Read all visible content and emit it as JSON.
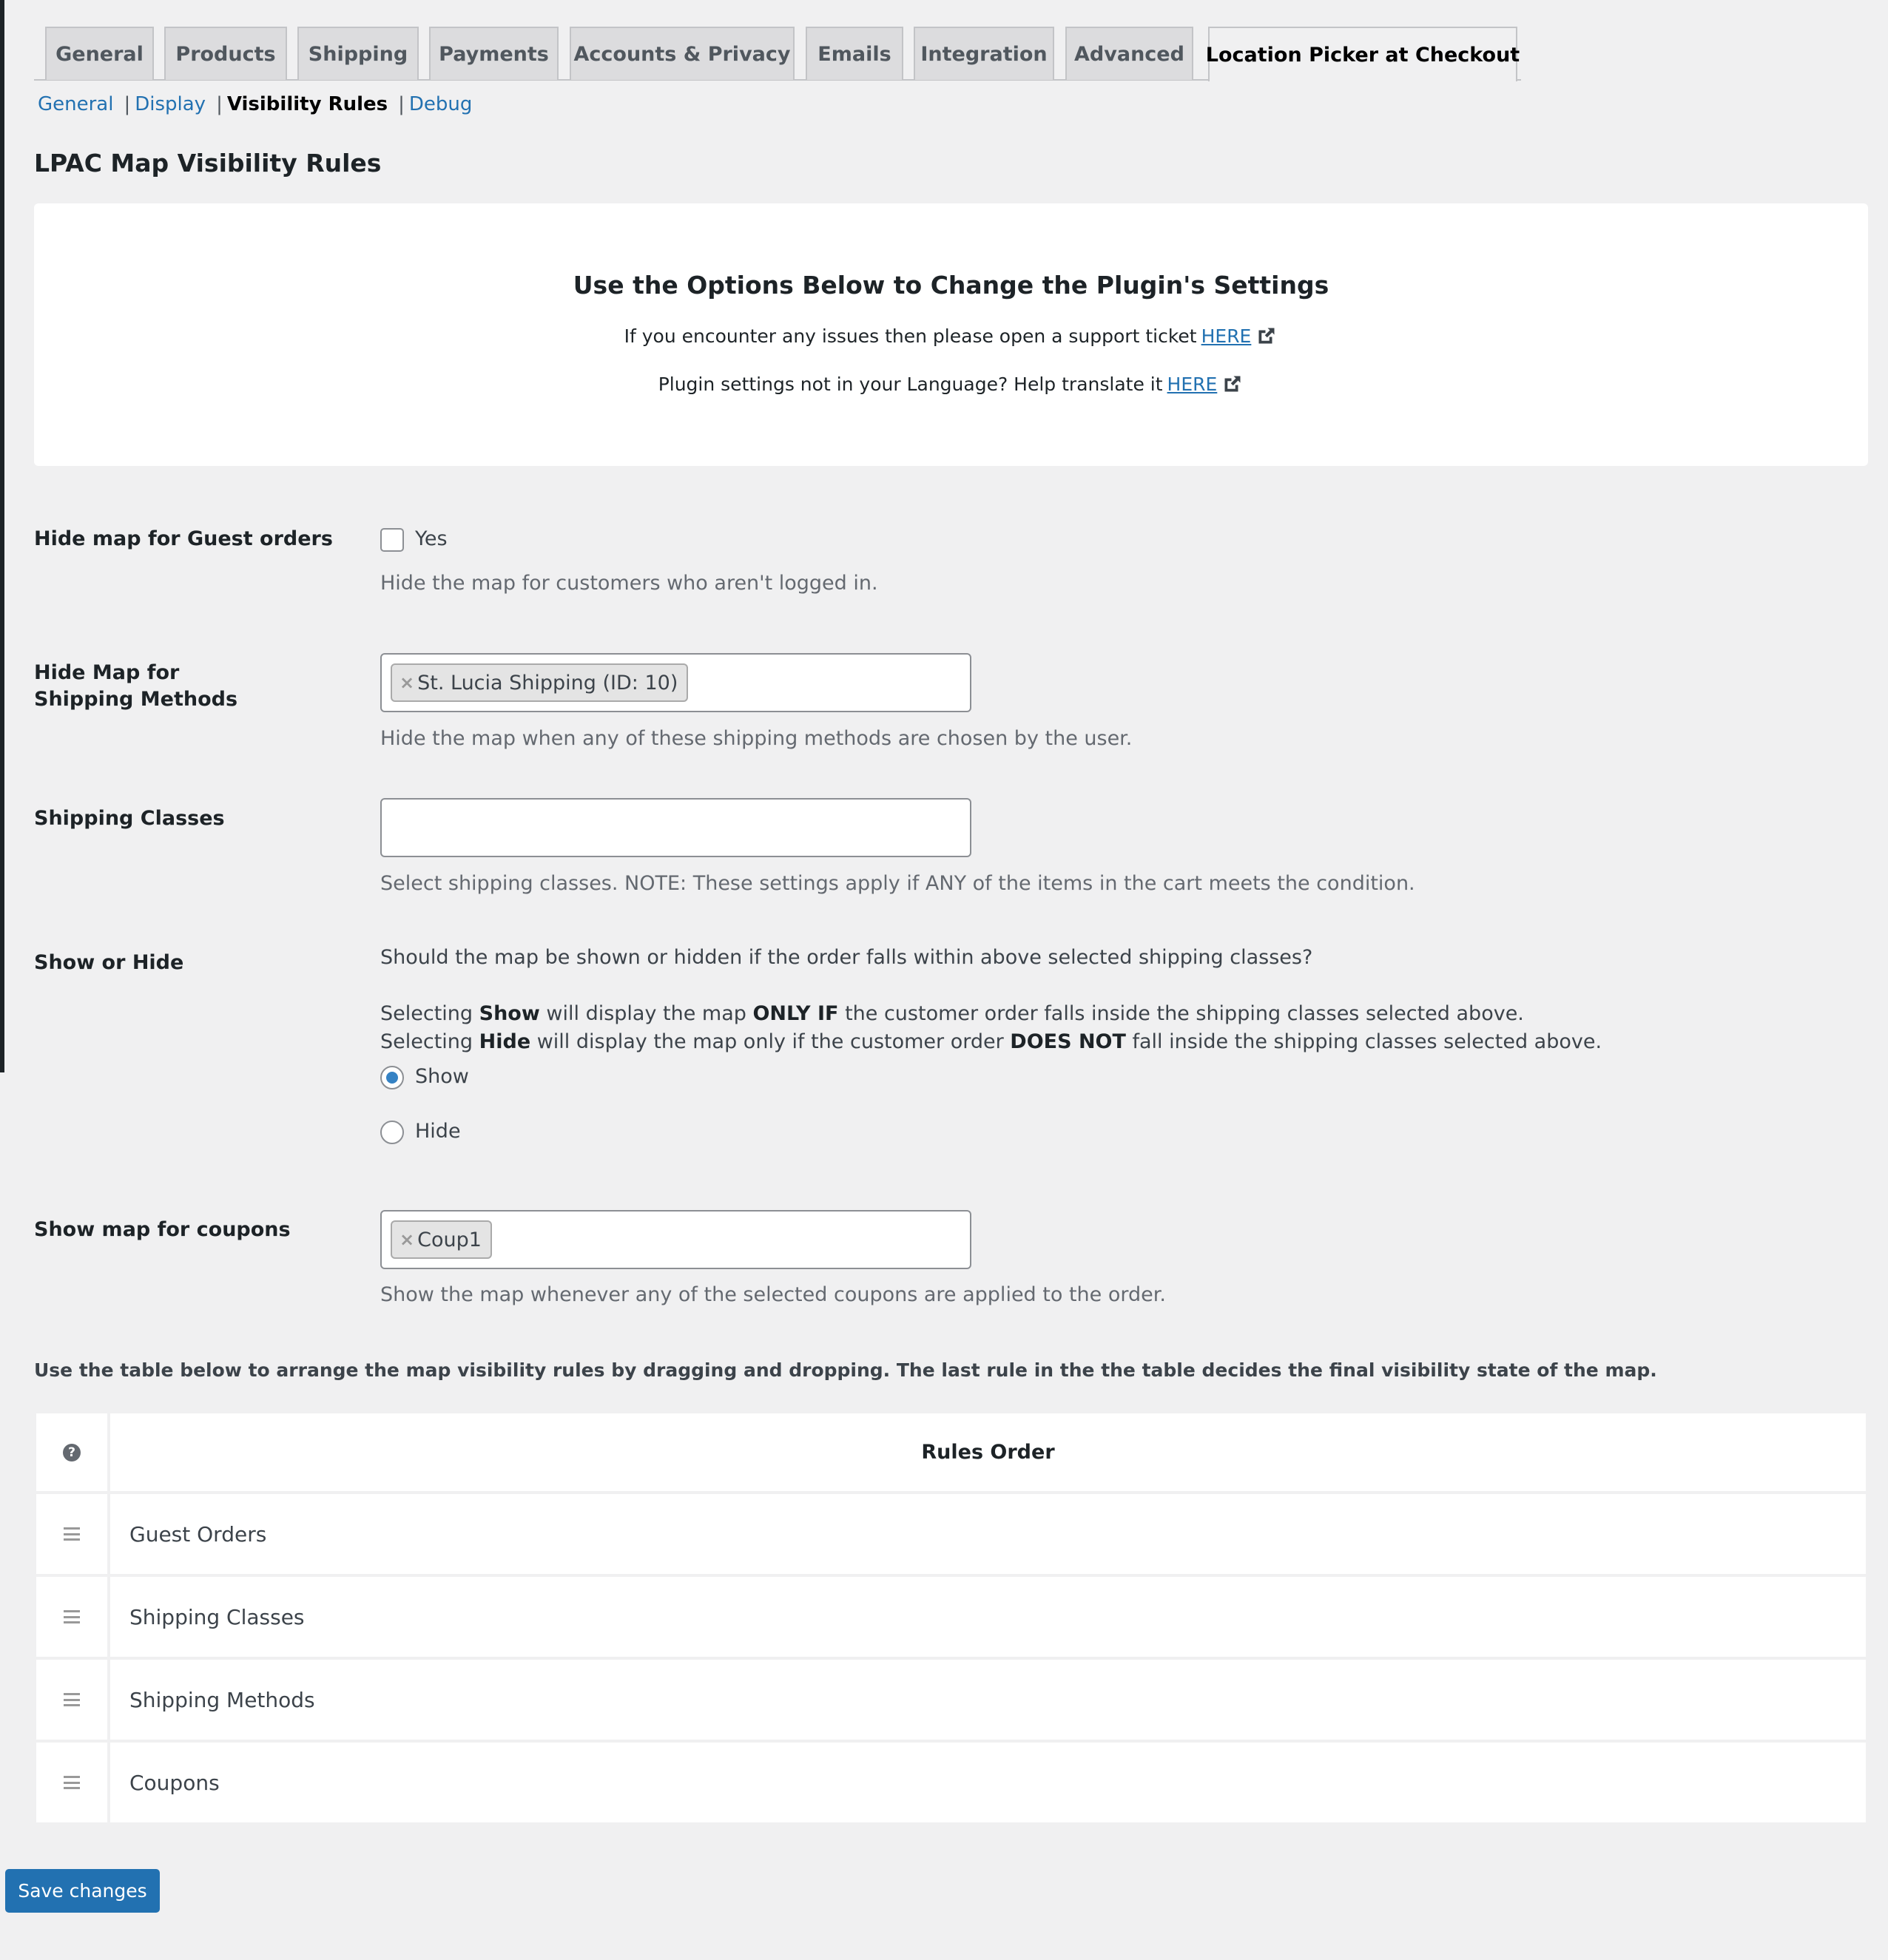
{
  "tabs": [
    {
      "label": "General",
      "active": false
    },
    {
      "label": "Products",
      "active": false
    },
    {
      "label": "Shipping",
      "active": false
    },
    {
      "label": "Payments",
      "active": false
    },
    {
      "label": "Accounts & Privacy",
      "active": false
    },
    {
      "label": "Emails",
      "active": false
    },
    {
      "label": "Integration",
      "active": false
    },
    {
      "label": "Advanced",
      "active": false
    },
    {
      "label": "Location Picker at Checkout",
      "active": true
    }
  ],
  "subnav": {
    "items": [
      {
        "label": "General",
        "current": false
      },
      {
        "label": "Display",
        "current": false
      },
      {
        "label": "Visibility Rules",
        "current": true
      },
      {
        "label": "Debug",
        "current": false
      }
    ],
    "separator": "|"
  },
  "page_title": "LPAC Map Visibility Rules",
  "info_box": {
    "title": "Use the Options Below to Change the Plugin's Settings",
    "support_text": "If you encounter any issues then please open a support ticket",
    "support_link": "HERE",
    "translate_text": "Plugin settings not in your Language? Help translate it",
    "translate_link": "HERE"
  },
  "guest_orders": {
    "label": "Hide map for Guest orders",
    "checkbox_label": "Yes",
    "checked": false,
    "description": "Hide the map for customers who aren't logged in."
  },
  "shipping_methods": {
    "label": "Hide Map for Shipping Methods",
    "selected": [
      "St. Lucia Shipping (ID: 10)"
    ],
    "remove_symbol": "×",
    "description": "Hide the map when any of these shipping methods are chosen by the user."
  },
  "shipping_classes": {
    "label": "Shipping Classes",
    "selected": [],
    "description": "Select shipping classes. NOTE: These settings apply if ANY of the items in the cart meets the condition."
  },
  "show_or_hide": {
    "label": "Show or Hide",
    "question": "Should the map be shown or hidden if the order falls within above selected shipping classes?",
    "line1": {
      "pre": "Selecting ",
      "bold1": "Show",
      "mid": " will display the map ",
      "bold2": "ONLY IF",
      "post": " the customer order falls inside the shipping classes selected above."
    },
    "line2": {
      "pre": "Selecting ",
      "bold1": "Hide",
      "mid": " will display the map only if the customer order ",
      "bold2": "DOES NOT",
      "post": " fall inside the shipping classes selected above."
    },
    "options": [
      {
        "label": "Show",
        "checked": true
      },
      {
        "label": "Hide",
        "checked": false
      }
    ]
  },
  "coupons": {
    "label": "Show map for coupons",
    "selected": [
      "Coup1"
    ],
    "remove_symbol": "×",
    "description": "Show the map whenever any of the selected coupons are applied to the order."
  },
  "rules_table": {
    "instruction": "Use the table below to arrange the map visibility rules by dragging and dropping. The last rule in the the table decides the final visibility state of the map.",
    "help_symbol": "?",
    "header": "Rules Order",
    "rows": [
      "Guest Orders",
      "Shipping Classes",
      "Shipping Methods",
      "Coupons"
    ]
  },
  "save_button": "Save changes",
  "colors": {
    "accent": "#2271b1",
    "radio_checked": "#3582c4",
    "background": "#f0f0f1",
    "admin_bar": "#1d2327"
  }
}
